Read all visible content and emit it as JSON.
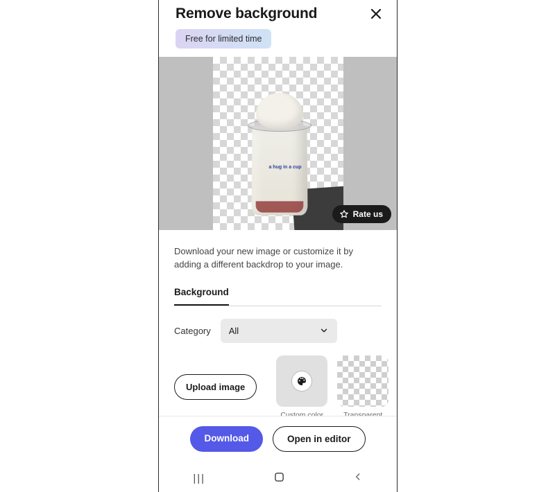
{
  "header": {
    "title": "Remove background",
    "close_icon": "close"
  },
  "promo_badge": "Free for limited time",
  "preview": {
    "rate_label": "Rate us",
    "cup_text_line1": "a hug in a cup"
  },
  "description": "Download your new image or customize it by adding a different backdrop to your image.",
  "tabs": {
    "background": "Background"
  },
  "category": {
    "label": "Category",
    "selected": "All"
  },
  "gallery": {
    "upload_label": "Upload image",
    "custom_color_label": "Custom color",
    "transparent_label": "Transparent"
  },
  "footer": {
    "download": "Download",
    "open_editor": "Open in editor"
  },
  "colors": {
    "primary": "#5459e8"
  }
}
